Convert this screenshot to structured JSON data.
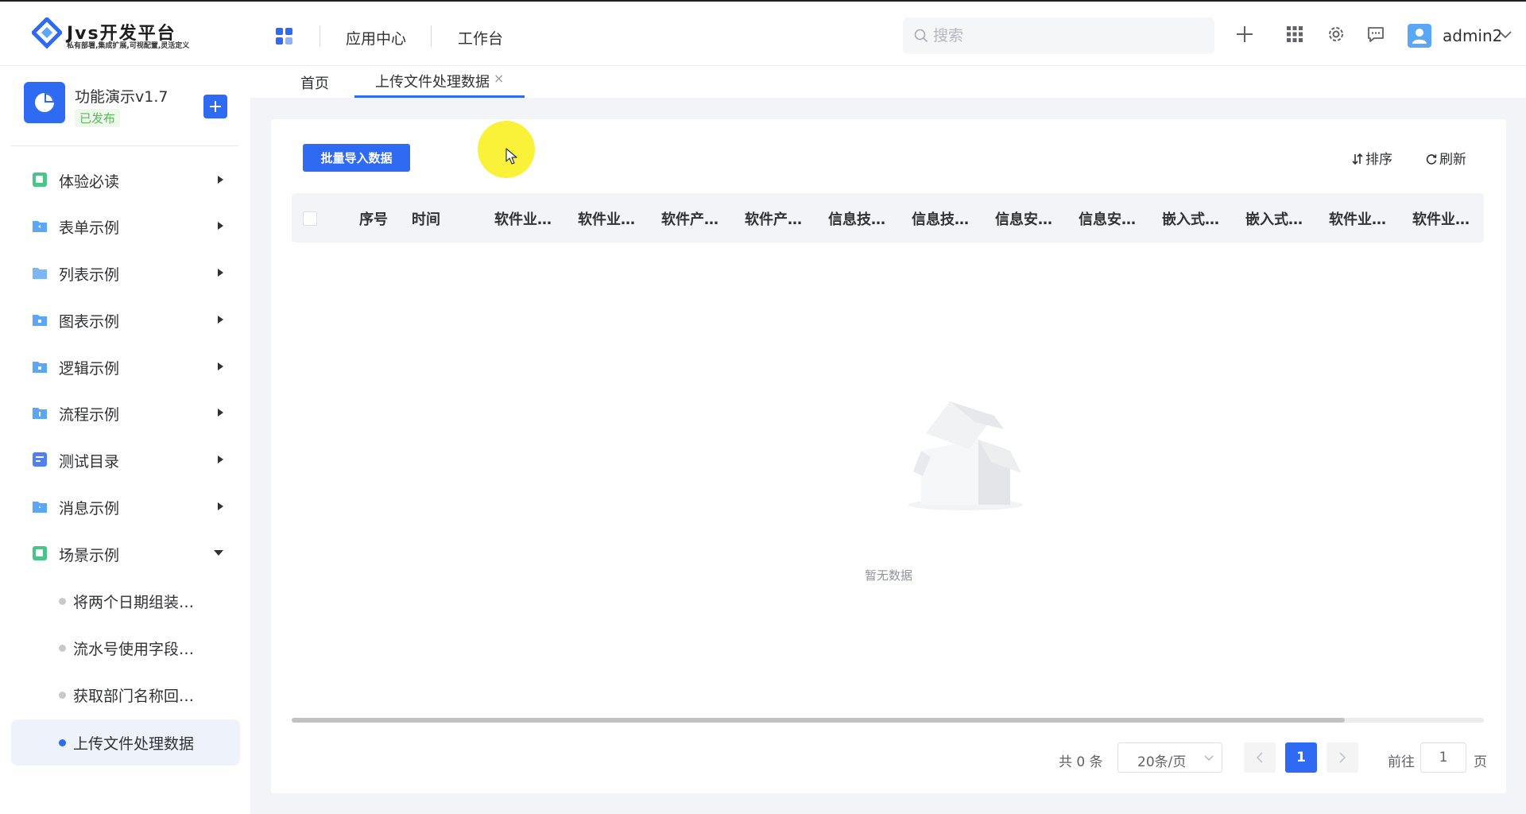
{
  "header": {
    "logo_title": "Jvs开发平台",
    "logo_subtitle": "私有部署,集成扩展,可视配置,灵活定义",
    "nav": [
      "应用中心",
      "工作台"
    ],
    "search_placeholder": "搜索",
    "user_name": "admin2"
  },
  "sidebar": {
    "app_name": "功能演示v1.7",
    "app_status": "已发布",
    "menu": [
      {
        "label": "体验必读",
        "color": "#4cc38a"
      },
      {
        "label": "表单示例",
        "color": "#5aa7f5"
      },
      {
        "label": "列表示例",
        "color": "#5aa7f5"
      },
      {
        "label": "图表示例",
        "color": "#5aa7f5"
      },
      {
        "label": "逻辑示例",
        "color": "#5aa7f5"
      },
      {
        "label": "流程示例",
        "color": "#5aa7f5"
      },
      {
        "label": "测试目录",
        "color": "#4f7ff0"
      },
      {
        "label": "消息示例",
        "color": "#5aa7f5"
      },
      {
        "label": "场景示例",
        "color": "#4cc38a"
      }
    ],
    "sub_items": [
      "将两个日期组装…",
      "流水号使用字段…",
      "获取部门名称回…",
      "上传文件处理数据"
    ]
  },
  "tabs": [
    "首页",
    "上传文件处理数据"
  ],
  "toolbar": {
    "import_label": "批量导入数据",
    "sort_label": "排序",
    "refresh_label": "刷新"
  },
  "table": {
    "columns": [
      "序号",
      "时间",
      "软件业…",
      "软件业…",
      "软件产…",
      "软件产…",
      "信息技…",
      "信息技…",
      "信息安…",
      "信息安…",
      "嵌入式…",
      "嵌入式…",
      "软件业…",
      "软件业…"
    ],
    "empty_text": "暂无数据"
  },
  "pagination": {
    "total": "共 0 条",
    "page_size": "20条/页",
    "current_page": "1",
    "goto_label": "前往",
    "goto_value": "1",
    "page_suffix": "页"
  },
  "colors": {
    "primary": "#2f6bf2",
    "published_green": "#5cb85c"
  }
}
